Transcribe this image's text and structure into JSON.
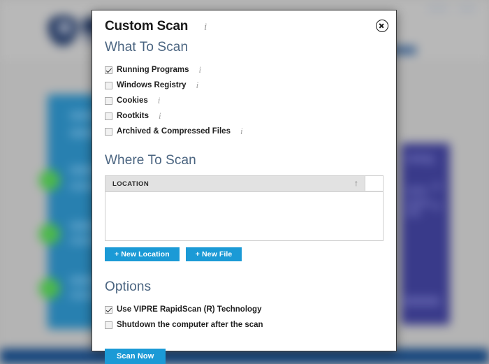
{
  "background": {
    "description": "blurred VIPRE antivirus application window behind modal",
    "brand_navy": "#253a63",
    "card_blue": "#2880b0",
    "card_purple": "#393a8a",
    "status_green": "#4cb84c",
    "footer_blue": "#14447c"
  },
  "dialog": {
    "title": "Custom Scan",
    "title_info_icon": "info-icon",
    "close_icon": "close-icon",
    "accent_color": "#1b9ad6",
    "heading_color": "#4a6480",
    "what_to_scan": {
      "heading": "What To Scan",
      "items": [
        {
          "label": "Running Programs",
          "checked": true,
          "info": "i"
        },
        {
          "label": "Windows Registry",
          "checked": false,
          "info": "i"
        },
        {
          "label": "Cookies",
          "checked": false,
          "info": "i"
        },
        {
          "label": "Rootkits",
          "checked": false,
          "info": "i"
        },
        {
          "label": "Archived & Compressed Files",
          "checked": false,
          "info": "i"
        }
      ]
    },
    "where_to_scan": {
      "heading": "Where To Scan",
      "table": {
        "column_header": "LOCATION",
        "sort_indicator": "↑",
        "rows": []
      },
      "buttons": [
        {
          "label": "+ New Location"
        },
        {
          "label": "+ New File"
        }
      ]
    },
    "options": {
      "heading": "Options",
      "items": [
        {
          "label": "Use VIPRE RapidScan (R) Technology",
          "checked": true
        },
        {
          "label": "Shutdown the computer after the scan",
          "checked": false
        }
      ]
    },
    "primary_button": {
      "label": "Scan Now"
    }
  }
}
